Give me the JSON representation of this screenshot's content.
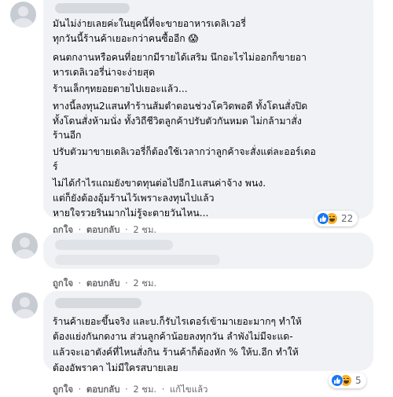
{
  "comments": [
    {
      "lines": [
        "มันไม่ง่ายเลยค่ะในยุคนี้ที่จะขายอาหารเดลิเวอรี่",
        "ทุกวันนี้ร้านค้าเยอะกว่าคนซื้ออีก 😱",
        "คนตกงานหรือคนที่อยากมีรายได้เสริม นึกอะไรไม่ออกก็ขายอา",
        "หารเดลิเวอรี่น่าจะง่ายสุด",
        "ร้านเล็กๆทยอยตายไปเยอะแล้ว...",
        "ทางนี้ลงทุน2แสนทำร้านส้มตำตอนช่วงโควิดพอดี ทั้งโดนสั่งปิด",
        "ทั้งโดนสั่งห้ามนั่ง ทั้งวิถีชีวิตลูกค้าปรับตัวกันหมด ไม่กล้ามาสั่ง",
        "ร้านอีก",
        "ปรับตัวมาขายเดลิเวอรี่ก็ต้องใช้เวลากว่าลูกค้าจะสั่งแต่ละออร์เดอ",
        "ร์",
        "ไม่ได้กำไรแถมยังขาดทุนต่อไปอีก1แสนค่าจ้าง พนง.",
        "แต่ก็ยังต้องอุ้มร้านไว้เพราะลงทุนไปแล้ว",
        "หายใจรวยรินมากไม่รู้จะตายวันไหน..."
      ],
      "reactions": {
        "icons": [
          "like-icon",
          "haha-icon"
        ],
        "count": "22"
      },
      "actions": {
        "like": "ถูกใจ",
        "reply": "ตอบกลับ",
        "time": "2 ชม."
      }
    },
    {
      "lines": [],
      "actions": {
        "like": "ถูกใจ",
        "reply": "ตอบกลับ",
        "time": "2 ชม."
      }
    },
    {
      "lines": [
        "ร้านค้าเยอะขึ้นจริง และบ.ก็รับไรเดอร์เข้ามาเยอะมากๆ ทำให้",
        "ต้องแย่งกันกดงาน ส่วนลูกค้าน้อยลงทุกวัน ลำพังไม่มีจะแด-",
        "แล้วจะเอาตังค์ที่ไหนสั่งกิน ร้านค้าก็ต้องหัก % ให้บ.อีก ทำให้",
        "ต้องอัพราคา ไม่มีใครสบายเลย"
      ],
      "reactions": {
        "icons": [
          "like-icon",
          "haha-icon"
        ],
        "count": "5"
      },
      "actions": {
        "like": "ถูกใจ",
        "reply": "ตอบกลับ",
        "time": "2 ชม.",
        "edited": "แก้ไขแล้ว"
      }
    }
  ],
  "separator": "·",
  "colors": {
    "bubble": "#f0f2f5",
    "meta_text": "#65676b",
    "like_blue": "#1877f2",
    "haha_yellow": "#f7b125"
  }
}
